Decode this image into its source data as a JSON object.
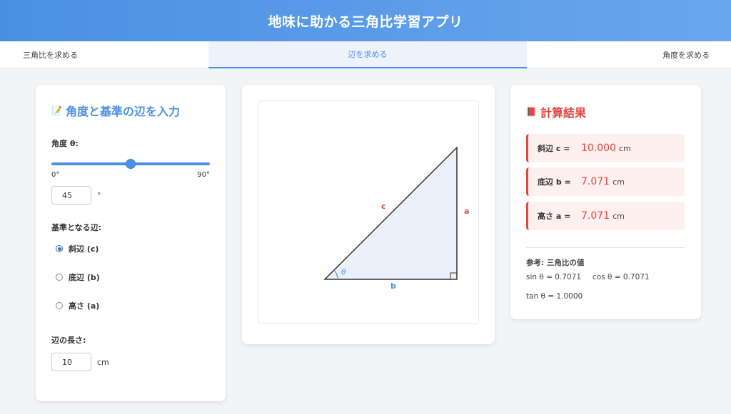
{
  "header": {
    "title": "地味に助かる三角比学習アプリ"
  },
  "tabs": [
    {
      "label": "三角比を求める"
    },
    {
      "label": "辺を求める"
    },
    {
      "label": "角度を求める"
    }
  ],
  "input_panel": {
    "title": "角度と基準の辺を入力",
    "angle_label": "角度 θ:",
    "angle_value": 45,
    "angle_max": 90,
    "angle_min_label": "0°",
    "angle_max_label": "90°",
    "angle_input_value": "45",
    "angle_unit": "°",
    "base_side_label": "基準となる辺:",
    "options": [
      {
        "label": "斜辺 (c)",
        "selected": true
      },
      {
        "label": "底辺 (b)",
        "selected": false
      },
      {
        "label": "高さ (a)",
        "selected": false
      }
    ],
    "length_label": "辺の長さ:",
    "length_value": "10",
    "length_unit": "cm"
  },
  "diagram": {
    "label_c": "c",
    "label_a": "a",
    "label_b": "b",
    "label_theta": "θ",
    "colors": {
      "fill": "#eaf1fa",
      "stroke": "#333333",
      "side_label": "#e2463f",
      "base_label": "#4a90e2"
    }
  },
  "results": {
    "title": "計算結果",
    "items": [
      {
        "label": "斜辺 c =",
        "value": "10.000",
        "unit": "cm"
      },
      {
        "label": "底辺 b =",
        "value": "7.071",
        "unit": "cm"
      },
      {
        "label": "高さ a =",
        "value": "7.071",
        "unit": "cm"
      }
    ],
    "ref_title": "参考: 三角比の値",
    "sin_text": "sin θ = 0.7071",
    "cos_text": "cos θ = 0.7071",
    "tan_text": "tan θ = 1.0000"
  },
  "colors": {
    "accent": "#4a90e2",
    "result": "#e2463f",
    "background": "#f3f4f6"
  }
}
